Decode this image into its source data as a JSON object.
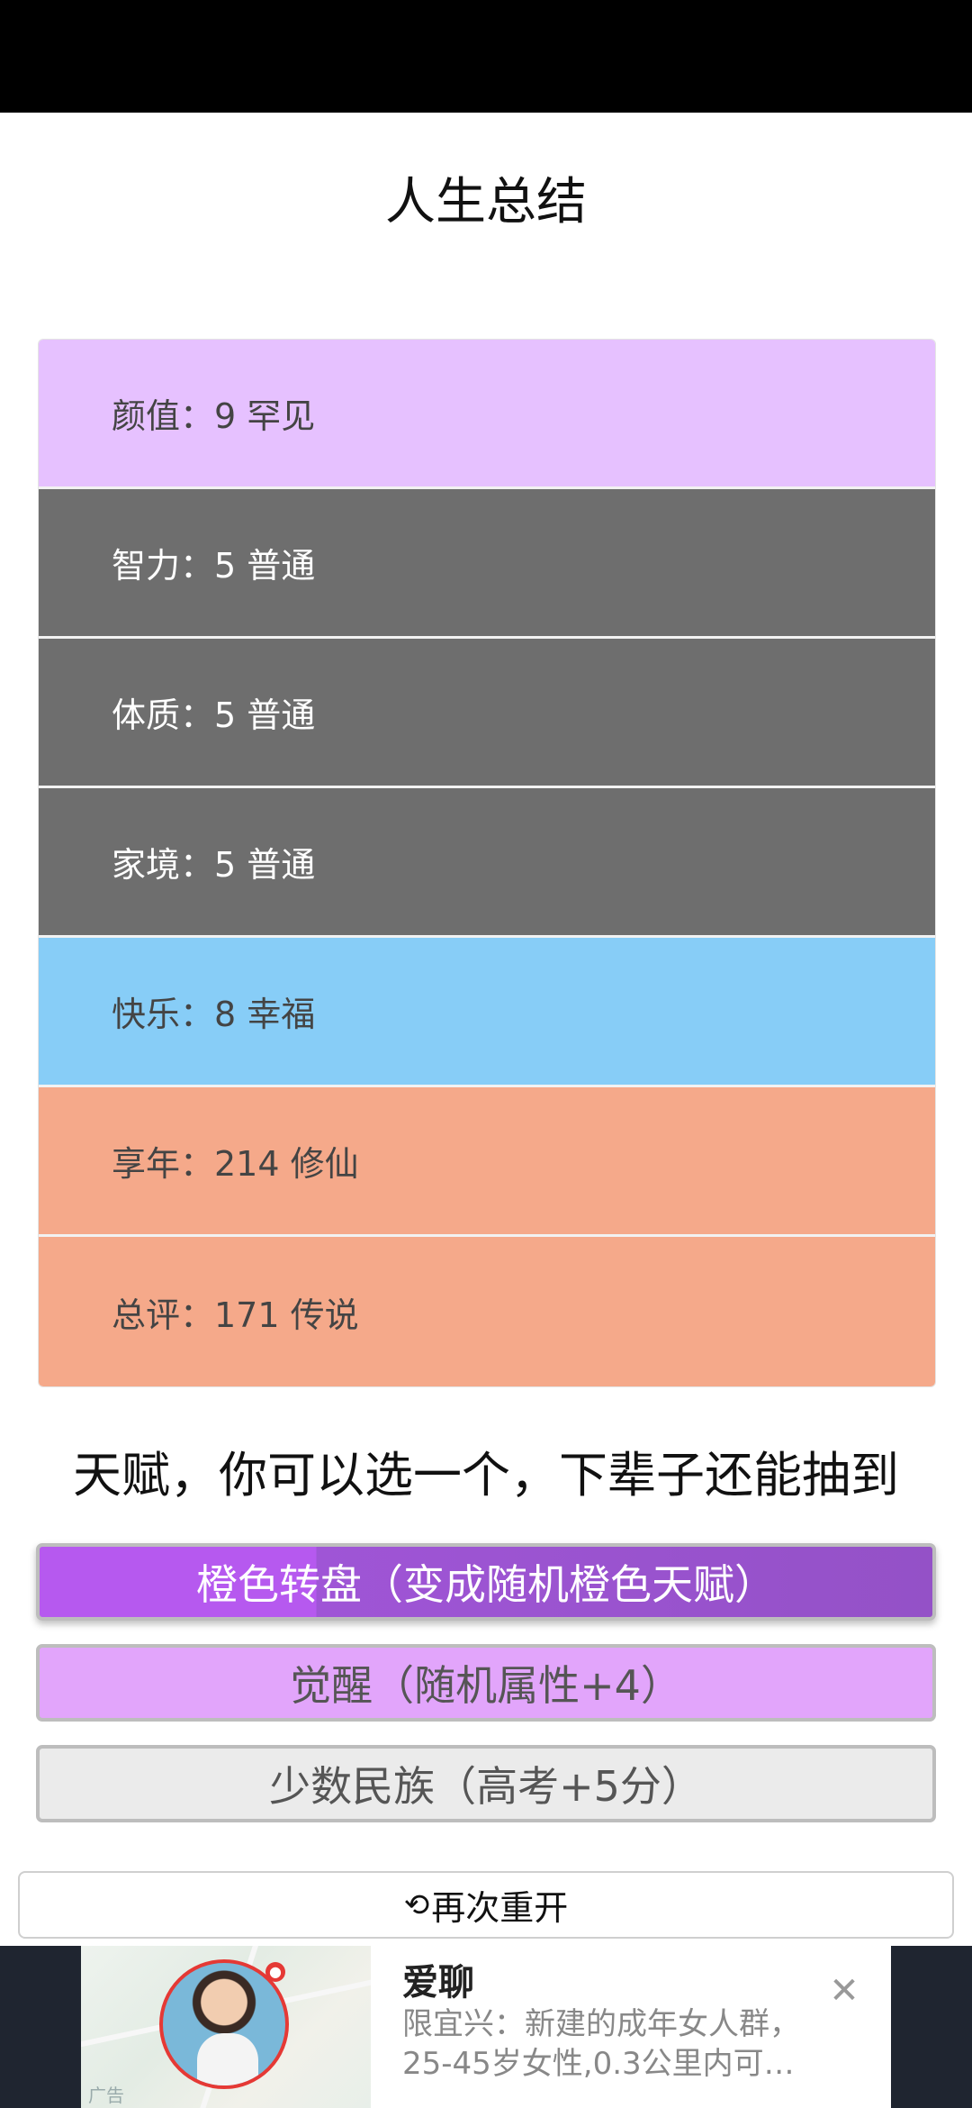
{
  "page": {
    "title": "人生总结"
  },
  "stats": [
    {
      "label": "颜值：9 罕见",
      "bg": "#e6c1ff",
      "color": "#444444"
    },
    {
      "label": "智力：5 普通",
      "bg": "#6e6e6e",
      "color": "#ffffff"
    },
    {
      "label": "体质：5 普通",
      "bg": "#6e6e6e",
      "color": "#ffffff"
    },
    {
      "label": "家境：5 普通",
      "bg": "#6e6e6e",
      "color": "#ffffff"
    },
    {
      "label": "快乐：8 幸福",
      "bg": "#87cdf7",
      "color": "#444444"
    },
    {
      "label": "享年：214 修仙",
      "bg": "#f5a98a",
      "color": "#444444"
    },
    {
      "label": "总评：171 传说",
      "bg": "#f5a98a",
      "color": "#444444"
    }
  ],
  "talents": {
    "title": "天赋，你可以选一个，下辈子还能抽到",
    "options": [
      {
        "label": "橙色转盘（变成随机橙色天赋）"
      },
      {
        "label": "觉醒（随机属性+4）"
      },
      {
        "label": "少数民族（高考+5分）"
      }
    ]
  },
  "restart": {
    "icon": "refresh-icon",
    "label": "再次重开"
  },
  "ad": {
    "title": "爱聊",
    "description": "限宜兴：新建的成年女人群，25-45岁女性,0.3公里内可…",
    "tag": "广告",
    "close_icon": "close-icon"
  }
}
